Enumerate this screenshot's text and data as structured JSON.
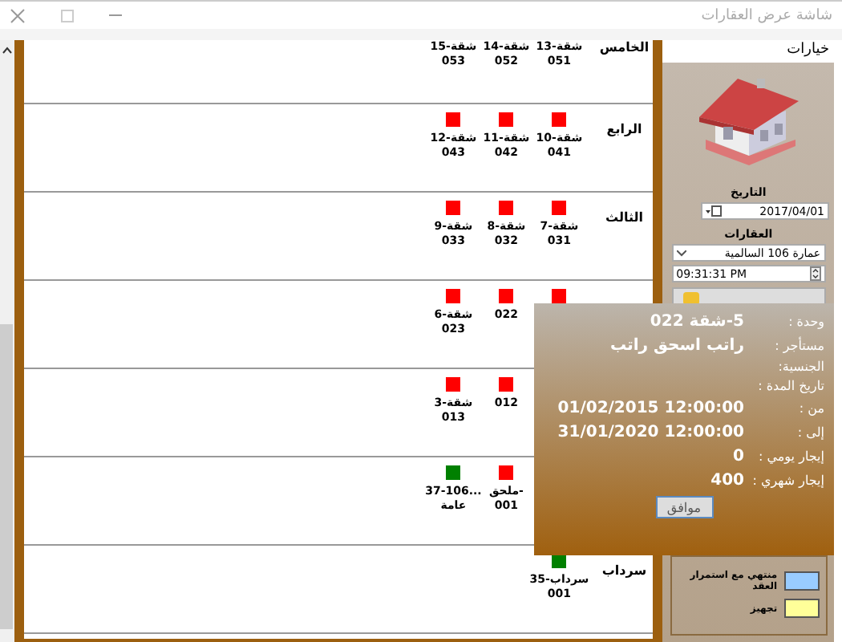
{
  "window": {
    "title": "شاشة عرض العقارات"
  },
  "options_header": "خيارات",
  "floors": [
    {
      "label": "الخامس",
      "units": [
        {
          "kind": "unit",
          "name": "13-شقة",
          "code": "051"
        },
        {
          "kind": "unit",
          "name": "14-شقة",
          "code": "052"
        },
        {
          "kind": "unit",
          "name": "15-شقة",
          "code": "053"
        }
      ]
    },
    {
      "label": "الرابع",
      "units": [
        {
          "kind": "unit",
          "name": "10-شقة",
          "code": "041",
          "color": "#ff0000"
        },
        {
          "kind": "unit",
          "name": "11-شقة",
          "code": "042",
          "color": "#ff0000"
        },
        {
          "kind": "unit",
          "name": "12-شقة",
          "code": "043",
          "color": "#ff0000"
        }
      ]
    },
    {
      "label": "الثالث",
      "units": [
        {
          "kind": "unit",
          "name": "7-شقة",
          "code": "031",
          "color": "#ff0000"
        },
        {
          "kind": "unit",
          "name": "8-شقة",
          "code": "032",
          "color": "#ff0000"
        },
        {
          "kind": "unit",
          "name": "9-شقة",
          "code": "033",
          "color": "#ff0000"
        }
      ]
    },
    {
      "units": [
        {
          "kind": "unit",
          "color": "#ff0000"
        },
        {
          "kind": "unit",
          "code": "022",
          "color": "#ff0000"
        },
        {
          "kind": "unit",
          "name": "6-شقة",
          "code": "023",
          "color": "#ff0000"
        }
      ]
    },
    {
      "units": [
        {
          "kind": "covered"
        },
        {
          "kind": "unit",
          "code": "012",
          "color": "#ff0000"
        },
        {
          "kind": "unit",
          "name": "3-شقة",
          "code": "013",
          "color": "#ff0000"
        }
      ]
    },
    {
      "units": [
        {
          "kind": "covered"
        },
        {
          "kind": "unit",
          "name": "ملحق-",
          "code": "001",
          "color": "#ff0000"
        },
        {
          "kind": "unit",
          "name": "37-106...",
          "code": "عامة",
          "color": "#008000"
        }
      ]
    },
    {
      "label": "سرداب",
      "units": [
        {
          "kind": "unit",
          "name": "35-سرداب",
          "code": "001",
          "color": "#008000"
        }
      ]
    }
  ],
  "panel": {
    "date_label": "التاريخ",
    "date": "2017/04/01",
    "properties_label": "العقارات",
    "property": "عمارة 106 السالمية",
    "time": "09:31:31 PM"
  },
  "legend": [
    {
      "label": "منتهي مع استمرار العقد",
      "color": "#99ccff"
    },
    {
      "label": "تجهيز",
      "color": "#ffff99"
    }
  ],
  "popup": {
    "fields": [
      {
        "label": "وحدة :",
        "value": "5-شقة 022"
      },
      {
        "label": "مستأجر :",
        "value": "راتب اسحق راتب"
      },
      {
        "label": "الجنسية:"
      },
      {
        "label": "تاريخ المدة :"
      },
      {
        "label": "من :",
        "value": "12:00:00 01/02/2015"
      },
      {
        "label": "إلى :",
        "value": "12:00:00 31/01/2020"
      },
      {
        "label": "إيجار يومي :",
        "value": "0"
      },
      {
        "label": "إيجار شهري :",
        "value": "400"
      }
    ],
    "button": "موافق"
  }
}
